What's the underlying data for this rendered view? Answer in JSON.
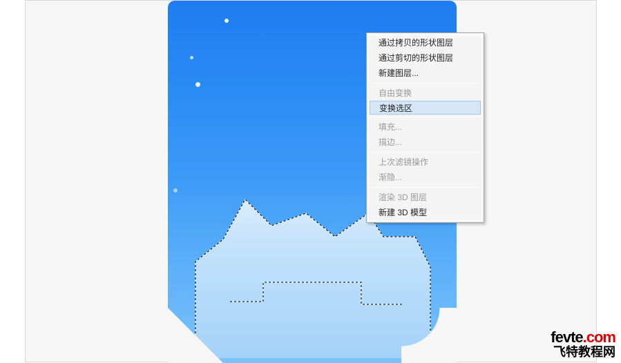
{
  "menu": {
    "items": [
      {
        "label": "通过拷贝的形状图层",
        "enabled": true
      },
      {
        "label": "通过剪切的形状图层",
        "enabled": true
      },
      {
        "label": "新建图层...",
        "enabled": true
      }
    ],
    "group2": [
      {
        "label": "自由变换",
        "enabled": false
      },
      {
        "label": "变换选区",
        "enabled": true,
        "highlight": true
      }
    ],
    "group3": [
      {
        "label": "填充...",
        "enabled": false
      },
      {
        "label": "描边...",
        "enabled": false
      }
    ],
    "group4": [
      {
        "label": "上次滤镜操作",
        "enabled": false
      },
      {
        "label": "渐隐...",
        "enabled": false
      }
    ],
    "group5": [
      {
        "label": "渲染 3D 图层",
        "enabled": false
      },
      {
        "label": "新建 3D 模型",
        "enabled": true
      }
    ]
  },
  "watermark": {
    "line1a": "fevte",
    "line1b": ".com",
    "line2": "飞特教程网"
  }
}
